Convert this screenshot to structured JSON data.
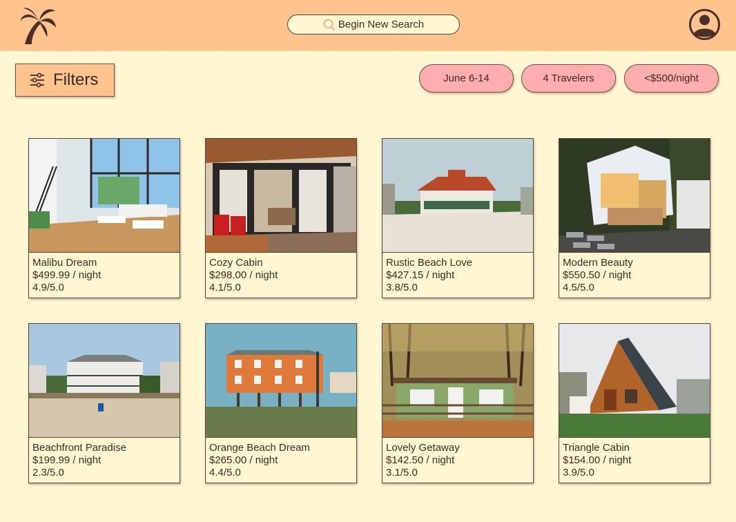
{
  "header": {
    "logo_icon": "palm-tree-icon",
    "search_placeholder": "Begin New Search",
    "search_icon": "search-icon",
    "profile_icon": "user-avatar-icon",
    "colors": {
      "bar": "#ffc48e",
      "brand": "#4a3028"
    }
  },
  "filters": {
    "label": "Filters",
    "icon": "sliders-icon"
  },
  "chips": [
    {
      "label": "June 6-14"
    },
    {
      "label": "4 Travelers"
    },
    {
      "label": "<$500/night"
    }
  ],
  "listings": [
    {
      "name": "Malibu Dream",
      "price": "$499.99 / night",
      "rating": "4.9/5.0",
      "image": "modern-interior-photo"
    },
    {
      "name": "Cozy Cabin",
      "price": "$298.00 / night",
      "rating": "4.1/5.0",
      "image": "cabin-porch-photo"
    },
    {
      "name": "Rustic Beach Love",
      "price": "$427.15 / night",
      "rating": "3.8/5.0",
      "image": "beach-house-photo"
    },
    {
      "name": "Modern Beauty",
      "price": "$550.50 / night",
      "rating": "4.5/5.0",
      "image": "modern-house-photo"
    },
    {
      "name": "Beachfront Paradise",
      "price": "$199.99 / night",
      "rating": "2.3/5.0",
      "image": "beachfront-house-photo"
    },
    {
      "name": "Orange Beach Dream",
      "price": "$265.00 / night",
      "rating": "4.4/5.0",
      "image": "orange-stilt-house-photo"
    },
    {
      "name": "Lovely Getaway",
      "price": "$142.50 / night",
      "rating": "3.1/5.0",
      "image": "green-cottage-photo"
    },
    {
      "name": "Triangle Cabin",
      "price": "$154.00 / night",
      "rating": "3.9/5.0",
      "image": "a-frame-cabin-photo"
    }
  ]
}
